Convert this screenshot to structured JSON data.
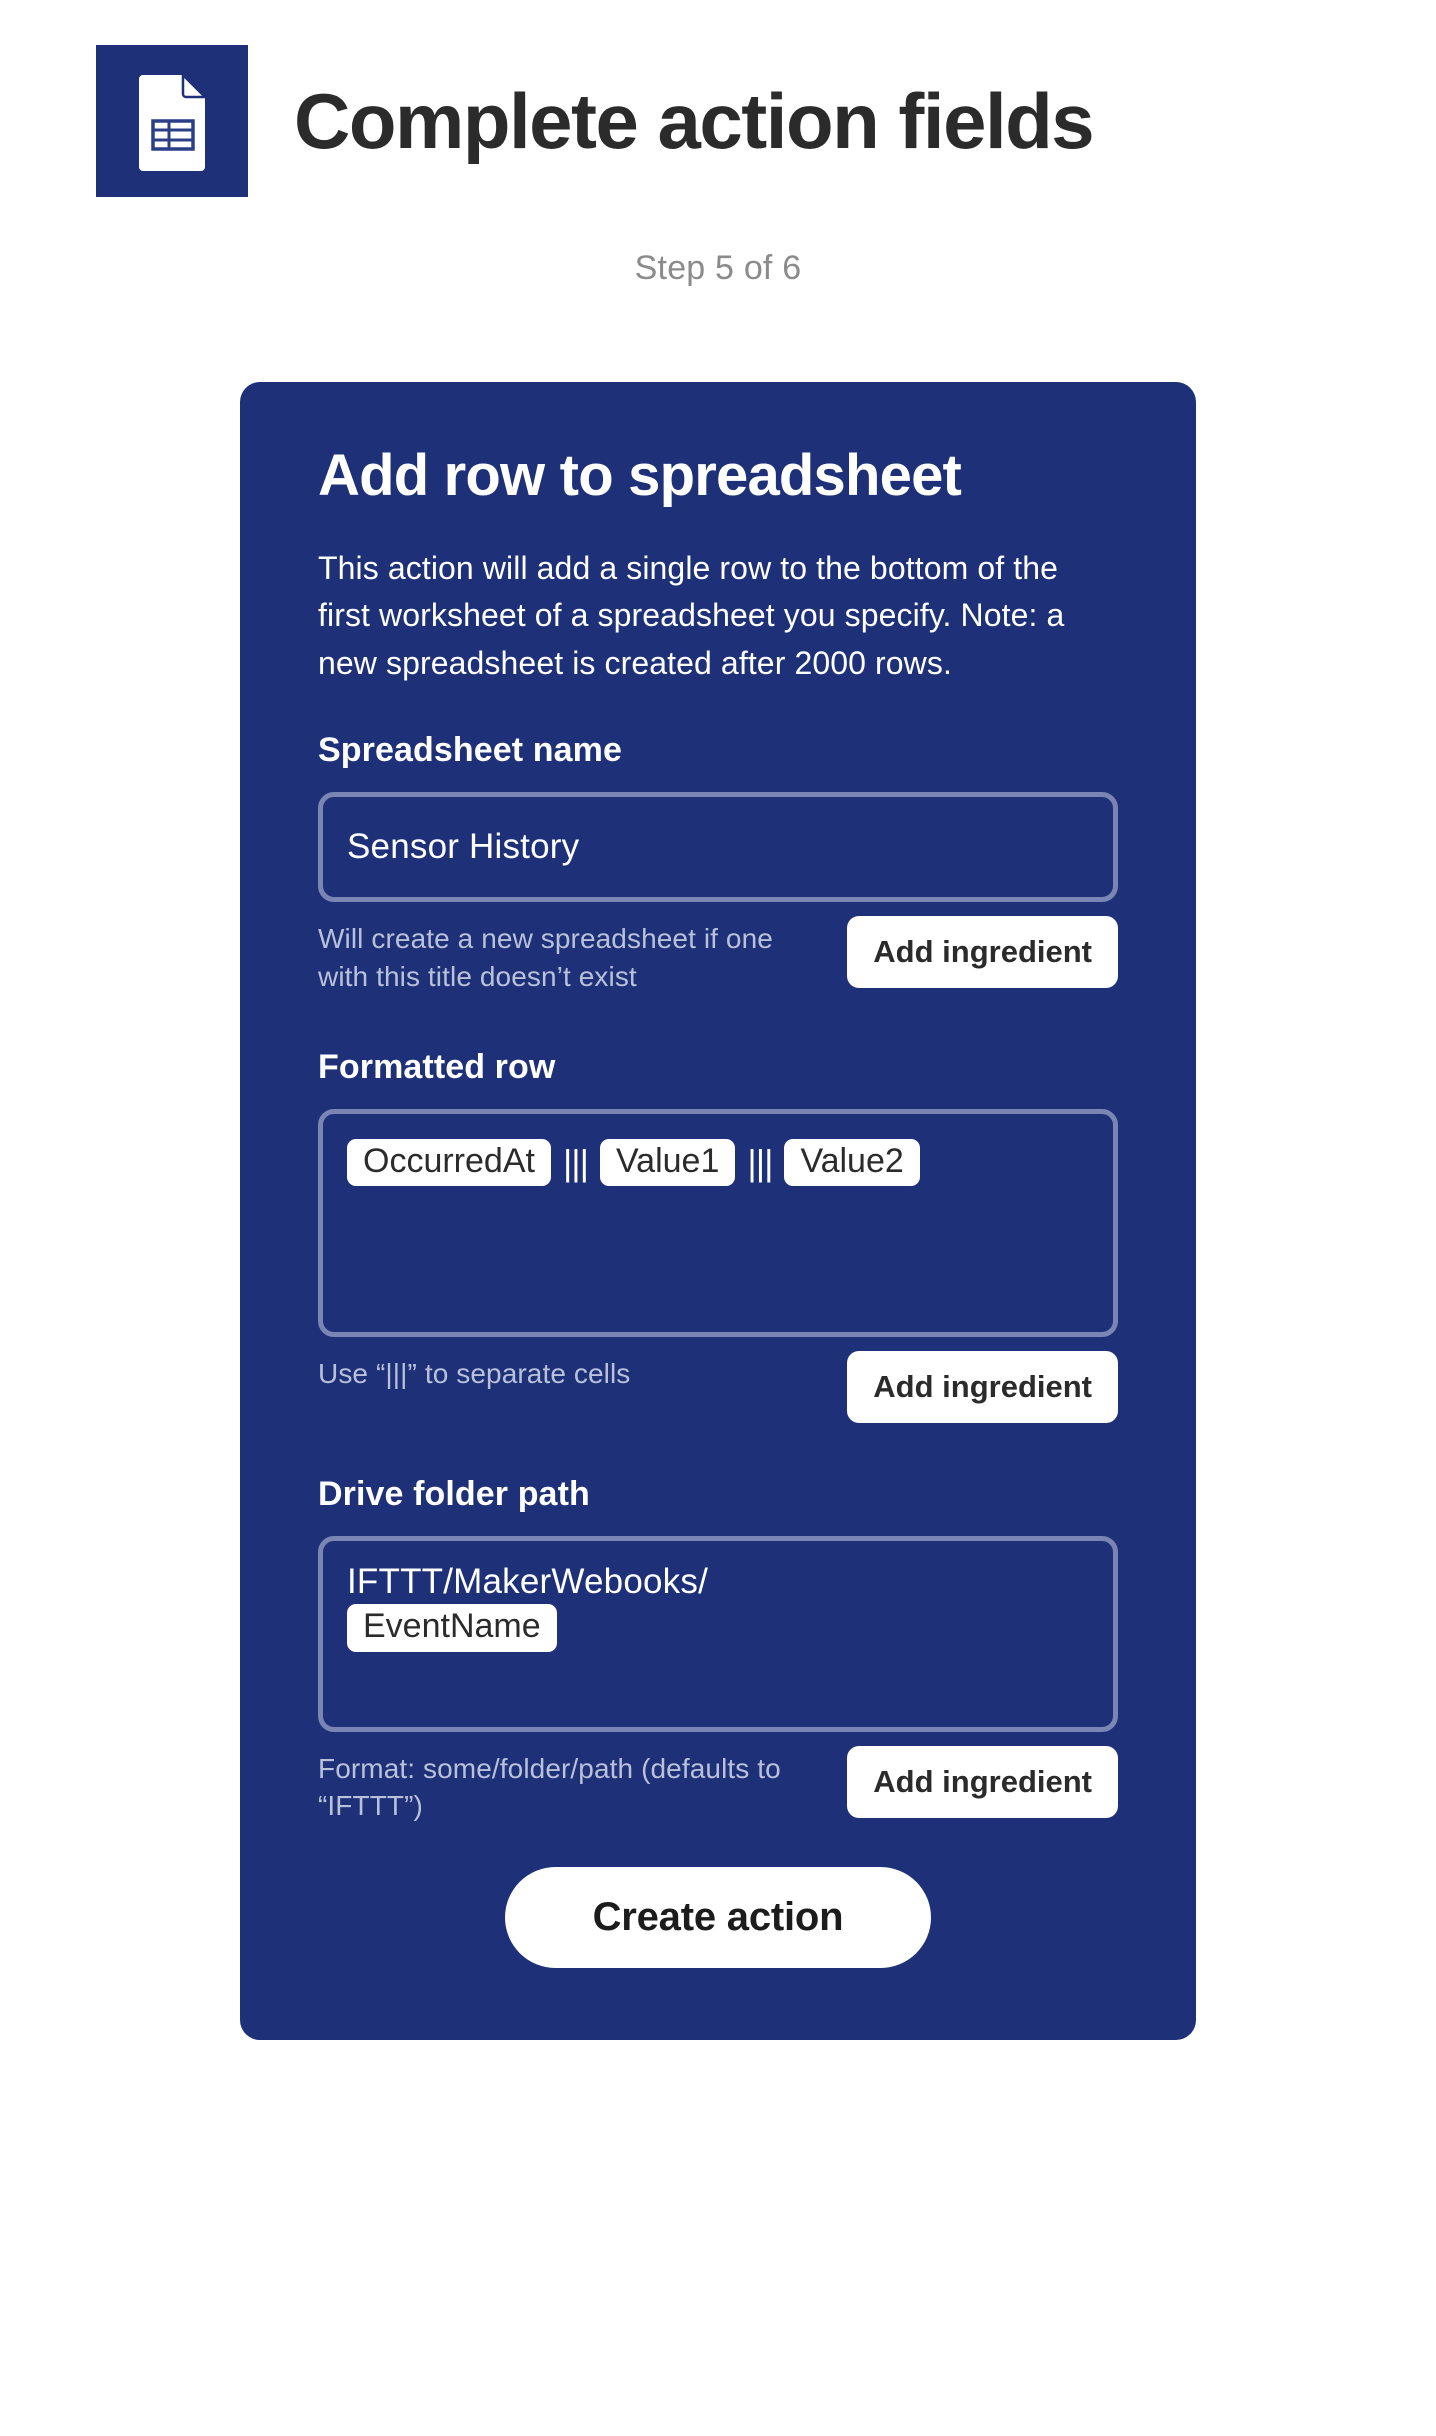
{
  "header": {
    "icon_name": "spreadsheet-document-icon",
    "icon_bg_color": "#1e3178",
    "title": "Complete action fields",
    "step_indicator": "Step 5 of 6"
  },
  "card": {
    "background_color": "#1e3178",
    "heading": "Add row to spreadsheet",
    "description": "This action will add a single row to the bottom of the first worksheet of a spreadsheet you specify. Note: a new spreadsheet is created after 2000 rows.",
    "fields": [
      {
        "label": "Spreadsheet name",
        "value": "Sensor History",
        "helper": "Will create a new spreadsheet if one with this title doesn’t exist",
        "button_label": "Add ingredient"
      },
      {
        "label": "Formatted row",
        "chips": [
          "OccurredAt",
          "Value1",
          "Value2"
        ],
        "separator": "|||",
        "helper": "Use “|||” to separate cells",
        "button_label": "Add ingredient"
      },
      {
        "label": "Drive folder path",
        "path_prefix": "IFTTT/MakerWebooks/",
        "path_chip": "EventName",
        "helper": "Format: some/folder/path (defaults to “IFTTT”)",
        "button_label": "Add ingredient"
      }
    ],
    "submit_label": "Create action"
  },
  "colors": {
    "brand_navy": "#1e3178",
    "field_border": "#7b85b4",
    "helper_text": "#b9c0d9",
    "title_text": "#2b2b2b",
    "step_text": "#8b8b8b"
  }
}
